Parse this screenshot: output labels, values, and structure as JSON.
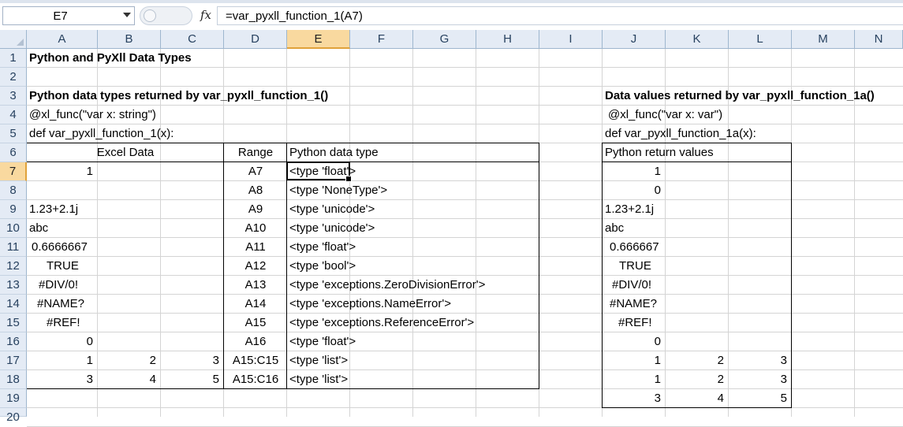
{
  "name_box": {
    "value": "E7"
  },
  "formula_bar": {
    "fx_label": "fx",
    "value": "=var_pyxll_function_1(A7)"
  },
  "columns": [
    "A",
    "B",
    "C",
    "D",
    "E",
    "F",
    "G",
    "H",
    "I",
    "J",
    "K",
    "L",
    "M",
    "N"
  ],
  "selected_column": "E",
  "rows": [
    "1",
    "2",
    "3",
    "4",
    "5",
    "6",
    "7",
    "8",
    "9",
    "10",
    "11",
    "12",
    "13",
    "14",
    "15",
    "16",
    "17",
    "18",
    "19",
    "20"
  ],
  "selected_row": "7",
  "sheet": {
    "title": "Python and PyXll Data Types",
    "left_heading": "Python data types returned by var_pyxll_function_1()",
    "left_decorator": "@xl_func(\"var x: string\")",
    "left_def": "def var_pyxll_function_1(x):",
    "right_heading": "Data values returned by var_pyxll_function_1a()",
    "right_decorator": "@xl_func(\"var x: var\")",
    "right_def": "def var_pyxll_function_1a(x):",
    "table_headers": {
      "excel_data": "Excel Data",
      "range": "Range",
      "python_type": "Python data type",
      "return_values": "Python return values"
    },
    "excel_data": [
      [
        "1",
        "",
        ""
      ],
      [
        "",
        "",
        ""
      ],
      [
        "1.23+2.1j",
        "",
        ""
      ],
      [
        "abc",
        "",
        ""
      ],
      [
        "0.6666667",
        "",
        ""
      ],
      [
        "TRUE",
        "",
        ""
      ],
      [
        "#DIV/0!",
        "",
        ""
      ],
      [
        "#NAME?",
        "",
        ""
      ],
      [
        "#REF!",
        "",
        ""
      ],
      [
        "0",
        "",
        ""
      ],
      [
        "1",
        "2",
        "3"
      ],
      [
        "3",
        "4",
        "5"
      ]
    ],
    "ranges": [
      "A7",
      "A8",
      "A9",
      "A10",
      "A11",
      "A12",
      "A13",
      "A14",
      "A15",
      "A16",
      "A15:C15",
      "A15:C16"
    ],
    "python_types": [
      "<type 'float'>",
      "<type 'NoneType'>",
      "<type 'unicode'>",
      "<type 'unicode'>",
      "<type 'float'>",
      "<type 'bool'>",
      "<type 'exceptions.ZeroDivisionError'>",
      "<type 'exceptions.NameError'>",
      "<type 'exceptions.ReferenceError'>",
      "<type 'float'>",
      "<type 'list'>",
      "<type 'list'>"
    ],
    "return_values": [
      [
        "1",
        "",
        ""
      ],
      [
        "0",
        "",
        ""
      ],
      [
        "1.23+2.1j",
        "",
        ""
      ],
      [
        "abc",
        "",
        ""
      ],
      [
        "0.666667",
        "",
        ""
      ],
      [
        "TRUE",
        "",
        ""
      ],
      [
        "#DIV/0!",
        "",
        ""
      ],
      [
        "#NAME?",
        "",
        ""
      ],
      [
        "#REF!",
        "",
        ""
      ],
      [
        "0",
        "",
        ""
      ],
      [
        "1",
        "2",
        "3"
      ],
      [
        "1",
        "2",
        "3"
      ],
      [
        "3",
        "4",
        "5"
      ]
    ]
  }
}
